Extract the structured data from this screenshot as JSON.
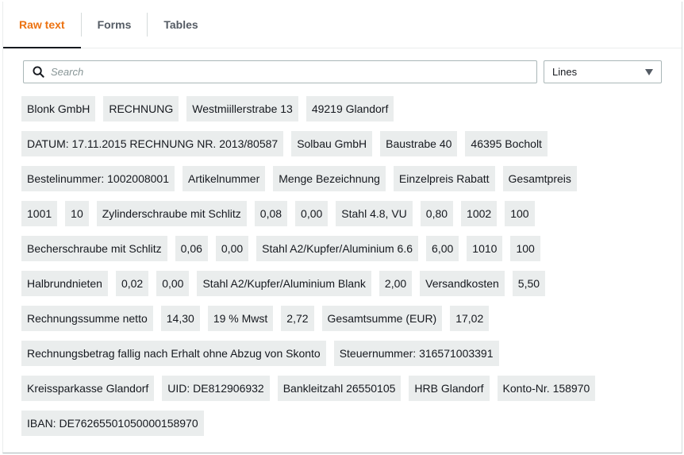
{
  "tabs": [
    {
      "label": "Raw text",
      "active": true
    },
    {
      "label": "Forms",
      "active": false
    },
    {
      "label": "Tables",
      "active": false
    }
  ],
  "search": {
    "placeholder": "Search",
    "value": ""
  },
  "view_select": {
    "value": "Lines"
  },
  "colors": {
    "accent": "#ec7211",
    "chip_bg": "#eaeded",
    "text": "#16191f"
  },
  "rows": [
    [
      "Blonk GmbH",
      "RECHNUNG",
      "Westmiillerstrabe 13",
      "49219 Glandorf"
    ],
    [
      "DATUM: 17.11.2015 RECHNUNG NR. 2013/80587",
      "Solbau GmbH",
      "Baustrabe 40",
      "46395 Bocholt"
    ],
    [
      "Bestelinummer: 1002008001",
      "Artikelnummer",
      "Menge Bezeichnung",
      "Einzelpreis Rabatt",
      "Gesamtpreis"
    ],
    [
      "1001",
      "10",
      "Zylinderschraube mit Schlitz",
      "0,08",
      "0,00",
      "Stahl 4.8, VU",
      "0,80",
      "1002",
      "100"
    ],
    [
      "Becherschraube mit Schlitz",
      "0,06",
      "0,00",
      "Stahl A2/Kupfer/Aluminium 6.6",
      "6,00",
      "1010",
      "100"
    ],
    [
      "Halbrundnieten",
      "0,02",
      "0,00",
      "Stahl A2/Kupfer/Aluminium Blank",
      "2,00",
      "Versandkosten",
      "5,50"
    ],
    [
      "Rechnungssumme netto",
      "14,30",
      "19 % Mwst",
      "2,72",
      "Gesamtsumme (EUR)",
      "17,02"
    ],
    [
      "Rechnungsbetrag fallig nach Erhalt ohne Abzug von Skonto",
      "Steuernummer: 316571003391"
    ],
    [
      "Kreissparkasse Glandorf",
      "UID: DE812906932",
      "Bankleitzahl 26550105",
      "HRB Glandorf",
      "Konto-Nr. 158970"
    ],
    [
      "IBAN: DE76265501050000158970"
    ]
  ]
}
